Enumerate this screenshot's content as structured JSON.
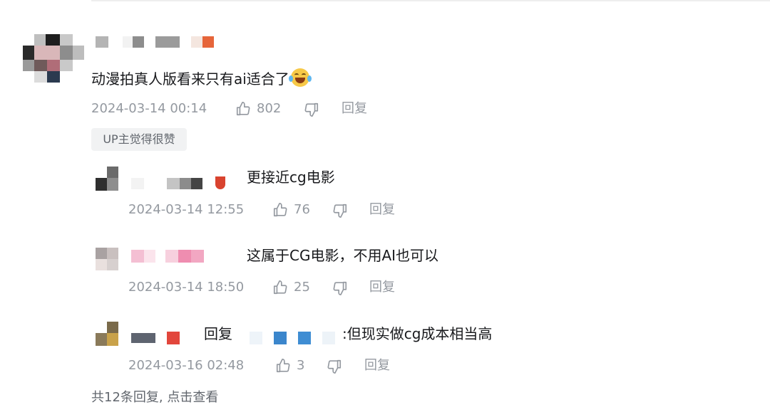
{
  "comment": {
    "text": "动漫拍真人版看来只有ai适合了",
    "emoji_icon": "laughing-tears-emoji",
    "time": "2024-03-14 00:14",
    "likes": "802",
    "reply_label": "回复",
    "badge": "UP主觉得很赞"
  },
  "replies": [
    {
      "text": "更接近cg电影",
      "time": "2024-03-14 12:55",
      "likes": "76",
      "reply_label": "回复"
    },
    {
      "text": "这属于CG电影，不用AI也可以",
      "time": "2024-03-14 18:50",
      "likes": "25",
      "reply_label": "回复"
    },
    {
      "prefix": "回复",
      "text": ":但现实做cg成本相当高",
      "time": "2024-03-16 02:48",
      "likes": "3",
      "reply_label": "回复"
    }
  ],
  "view_more": "共12条回复, 点击查看",
  "icons": {
    "like": "thumbs-up-icon",
    "dislike": "thumbs-down-icon"
  },
  "colors": {
    "text": "#18191c",
    "meta": "#9499a0",
    "badge_bg": "#f1f2f3"
  }
}
